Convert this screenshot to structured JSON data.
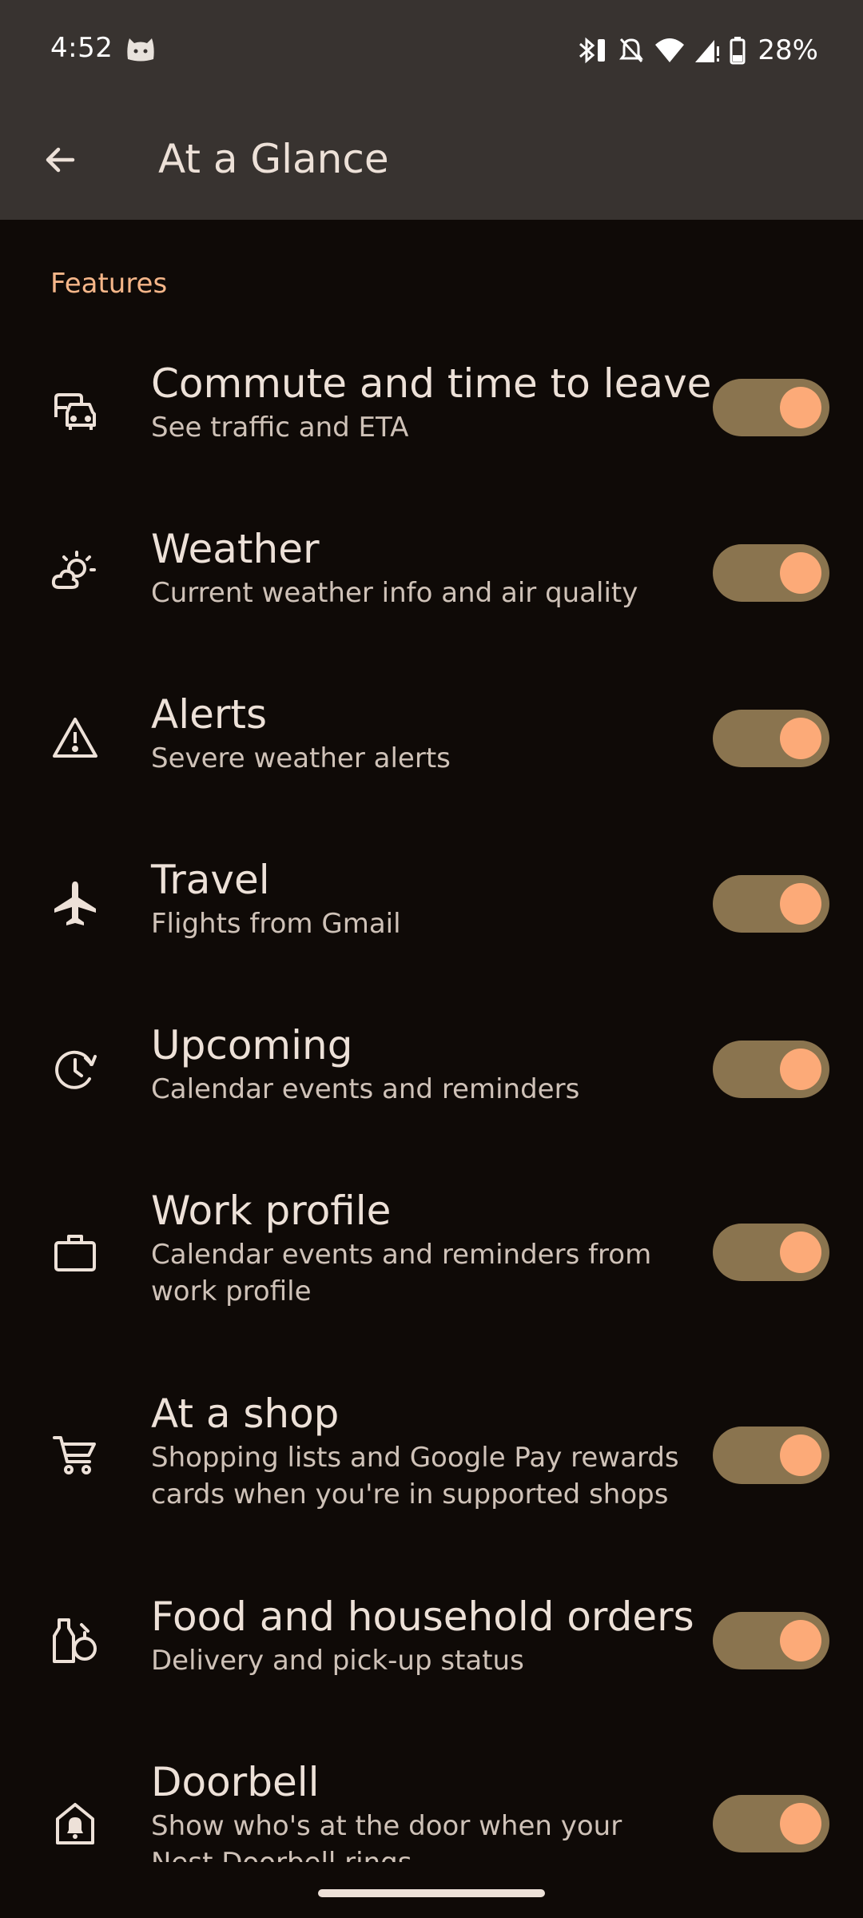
{
  "status_bar": {
    "time": "4:52",
    "battery_percent": "28%",
    "icons": [
      "cat-notification-icon",
      "bluetooth-battery-icon",
      "silent-icon",
      "wifi-icon",
      "signal-icon",
      "battery-icon"
    ]
  },
  "app_bar": {
    "title": "At a Glance"
  },
  "section": {
    "header": "Features"
  },
  "features": [
    {
      "icon": "commute-icon",
      "title": "Commute and time to leave",
      "summary": "See traffic and ETA",
      "enabled": true
    },
    {
      "icon": "weather-icon",
      "title": "Weather",
      "summary": "Current weather info and air quality",
      "enabled": true
    },
    {
      "icon": "alert-icon",
      "title": "Alerts",
      "summary": "Severe weather alerts",
      "enabled": true
    },
    {
      "icon": "flight-icon",
      "title": "Travel",
      "summary": "Flights from Gmail",
      "enabled": true
    },
    {
      "icon": "upcoming-icon",
      "title": "Upcoming",
      "summary": "Calendar events and reminders",
      "enabled": true
    },
    {
      "icon": "work-briefcase-icon",
      "title": "Work profile",
      "summary": "Calendar events and reminders from work profile",
      "enabled": true
    },
    {
      "icon": "shopping-cart-icon",
      "title": "At a shop",
      "summary": "Shopping lists and Google Pay rewards cards when you're in supported shops",
      "enabled": true
    },
    {
      "icon": "food-orders-icon",
      "title": "Food and household orders",
      "summary": "Delivery and pick-up status",
      "enabled": true
    },
    {
      "icon": "doorbell-icon",
      "title": "Doorbell",
      "summary": "Show who's at the door when your Nest Doorbell rings",
      "enabled": true
    }
  ],
  "colors": {
    "background": "#0f0a07",
    "app_bar": "#383330",
    "accent": "#f5b689",
    "toggle_track": "#8a744f",
    "toggle_thumb": "#fcaa78"
  }
}
